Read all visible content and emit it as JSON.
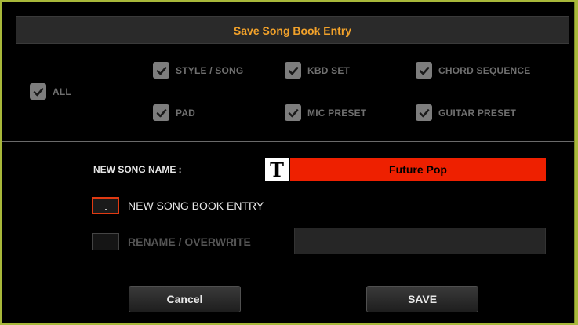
{
  "dialog": {
    "title": "Save Song Book Entry"
  },
  "checkboxes": {
    "all": {
      "label": "ALL",
      "checked": true
    },
    "style_song": {
      "label": "STYLE / SONG",
      "checked": true
    },
    "kbd_set": {
      "label": "KBD SET",
      "checked": true
    },
    "chord_sequence": {
      "label": "CHORD SEQUENCE",
      "checked": true
    },
    "pad": {
      "label": "PAD",
      "checked": true
    },
    "mic_preset": {
      "label": "MIC PRESET",
      "checked": true
    },
    "guitar_preset": {
      "label": "GUITAR PRESET",
      "checked": true
    }
  },
  "name": {
    "label": "NEW SONG NAME :",
    "text_icon": "T",
    "value": "Future Pop"
  },
  "options": {
    "new_entry": {
      "label": "NEW SONG BOOK ENTRY",
      "selected": true
    },
    "rename": {
      "label": "RENAME / OVERWRITE",
      "selected": false
    }
  },
  "buttons": {
    "cancel": "Cancel",
    "save": "SAVE"
  },
  "colors": {
    "accent": "#f2a22a",
    "name_field": "#ee2000",
    "selection_border": "#e03a12"
  }
}
